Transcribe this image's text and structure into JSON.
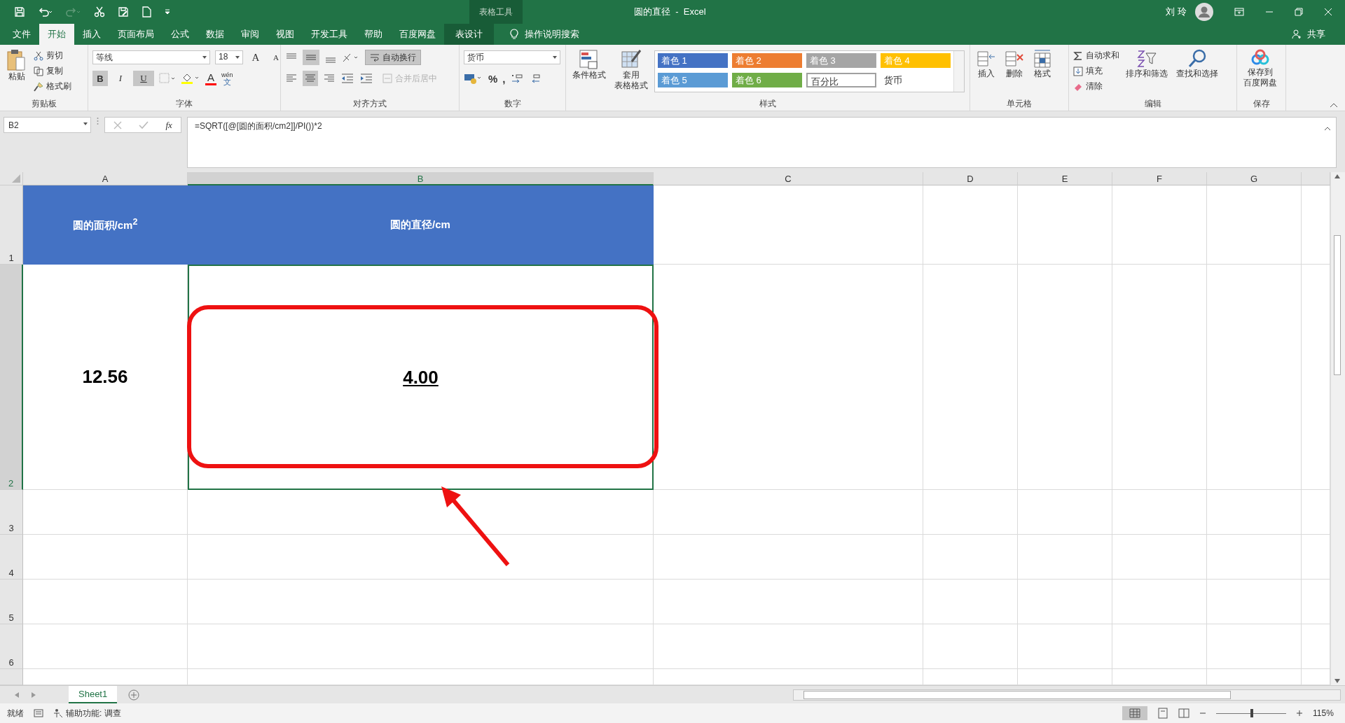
{
  "title_bar": {
    "context_label": "表格工具",
    "title": "圆的直径  -  Excel",
    "user": "刘 玲"
  },
  "tabs": [
    {
      "label": "文件",
      "selected": false,
      "kind": "normal"
    },
    {
      "label": "开始",
      "selected": true,
      "kind": "normal"
    },
    {
      "label": "插入",
      "selected": false,
      "kind": "normal"
    },
    {
      "label": "页面布局",
      "selected": false,
      "kind": "normal"
    },
    {
      "label": "公式",
      "selected": false,
      "kind": "normal"
    },
    {
      "label": "数据",
      "selected": false,
      "kind": "normal"
    },
    {
      "label": "审阅",
      "selected": false,
      "kind": "normal"
    },
    {
      "label": "视图",
      "selected": false,
      "kind": "normal"
    },
    {
      "label": "开发工具",
      "selected": false,
      "kind": "normal"
    },
    {
      "label": "帮助",
      "selected": false,
      "kind": "normal"
    },
    {
      "label": "百度网盘",
      "selected": false,
      "kind": "normal"
    },
    {
      "label": "表设计",
      "selected": false,
      "kind": "contextual"
    }
  ],
  "tell_me": "操作说明搜索",
  "share": "共享",
  "ribbon": {
    "clipboard": {
      "paste": "粘贴",
      "items": [
        "剪切",
        "复制",
        "格式刷"
      ],
      "label": "剪贴板"
    },
    "font": {
      "name": "等线",
      "size": "18",
      "grow": "A",
      "shrink": "A",
      "bold": "B",
      "italic": "I",
      "underline": "U",
      "font_color": "A",
      "phonetic": [
        "wén",
        "文"
      ],
      "label": "字体"
    },
    "alignment": {
      "wrap": {
        "label": "自动换行",
        "selected": true
      },
      "merge": {
        "label": "合并后居中",
        "disabled": true
      },
      "label": "对齐方式"
    },
    "number": {
      "format": "货币",
      "percent": "%",
      "comma": ",",
      "label": "数字"
    },
    "styles": {
      "conditional": "条件格式",
      "table_format": [
        "套用",
        "表格格式"
      ],
      "cell_styles": [
        {
          "label": "着色 1",
          "kind": "accent",
          "color": "#4472c4",
          "selected": false
        },
        {
          "label": "着色 2",
          "kind": "accent",
          "color": "#ed7d31",
          "selected": false
        },
        {
          "label": "着色 3",
          "kind": "accent",
          "color": "#a5a5a5",
          "selected": false
        },
        {
          "label": "着色 4",
          "kind": "accent",
          "color": "#ffc000",
          "selected": false
        },
        {
          "label": "着色 5",
          "kind": "accent",
          "color": "#5b9bd5",
          "selected": false
        },
        {
          "label": "着色 6",
          "kind": "accent",
          "color": "#70ad47",
          "selected": false
        },
        {
          "label": "百分比",
          "kind": "plain",
          "selected": true
        },
        {
          "label": "货币",
          "kind": "plain",
          "selected": false
        }
      ],
      "label": "样式"
    },
    "cells": {
      "items": [
        "插入",
        "删除",
        "格式"
      ],
      "label": "单元格"
    },
    "editing": {
      "autosum": "自动求和",
      "fill": "填充",
      "clear": "清除",
      "sort": "排序和筛选",
      "find": "查找和选择",
      "label": "编辑"
    },
    "save": {
      "lines": [
        "保存到",
        "百度网盘"
      ],
      "label": "保存"
    }
  },
  "formula_bar": {
    "name_box": "B2",
    "fx": "fx",
    "formula": "=SQRT([@[圆的面积/cm2]]/PI())*2"
  },
  "sheet": {
    "columns": [
      {
        "label": "A",
        "selected": false
      },
      {
        "label": "B",
        "selected": true
      },
      {
        "label": "C",
        "selected": false
      },
      {
        "label": "D",
        "selected": false
      },
      {
        "label": "E",
        "selected": false
      },
      {
        "label": "F",
        "selected": false
      },
      {
        "label": "G",
        "selected": false
      }
    ],
    "rows": [
      {
        "label": "1",
        "selected": false
      },
      {
        "label": "2",
        "selected": true
      },
      {
        "label": "3",
        "selected": false
      },
      {
        "label": "4",
        "selected": false
      },
      {
        "label": "5",
        "selected": false
      },
      {
        "label": "6",
        "selected": false
      }
    ],
    "header_cells": [
      "圆的面积/cm$^{2}$",
      "圆的直径/cm"
    ],
    "data_cells": [
      {
        "text": "12.56",
        "selected": false
      },
      {
        "text": "4.00",
        "selected": true
      }
    ]
  },
  "sheet_tabs": [
    {
      "label": "Sheet1",
      "selected": true
    }
  ],
  "status_bar": {
    "ready": "就绪",
    "accessibility": "辅助功能: 调查",
    "zoom": "115%",
    "zoom_slider": {
      "level": 0.51
    }
  }
}
